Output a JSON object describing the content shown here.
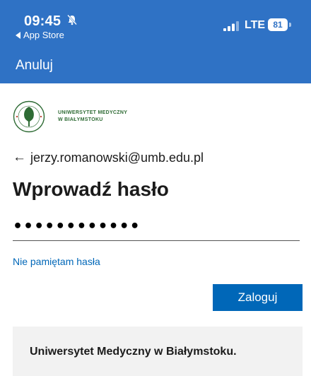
{
  "status_bar": {
    "time": "09:45",
    "back_app": "App Store",
    "network": "LTE",
    "battery": "81"
  },
  "nav": {
    "cancel_label": "Anuluj"
  },
  "logo": {
    "line1": "UNIWERSYTET MEDYCZNY",
    "line2": "W BIAŁYMSTOKU",
    "seal_text": "UNIWERSYTET MEDYCZNY W BIAŁYMSTOKU"
  },
  "account": {
    "email": "jerzy.romanowski@umb.edu.pl"
  },
  "form": {
    "title": "Wprowadź hasło",
    "password_value": "••••••••••••",
    "forgot_label": "Nie pamiętam hasła",
    "signin_label": "Zaloguj"
  },
  "footer": {
    "banner_text": "Uniwersytet Medyczny w Białymstoku."
  },
  "colors": {
    "header_bg": "#2f72c5",
    "link": "#0067b8",
    "button_bg": "#0067b8",
    "logo_green": "#2e6b34"
  },
  "icons": {
    "silent": "bell-slash-icon",
    "signal": "signal-bars-icon",
    "back": "arrow-left-icon"
  }
}
